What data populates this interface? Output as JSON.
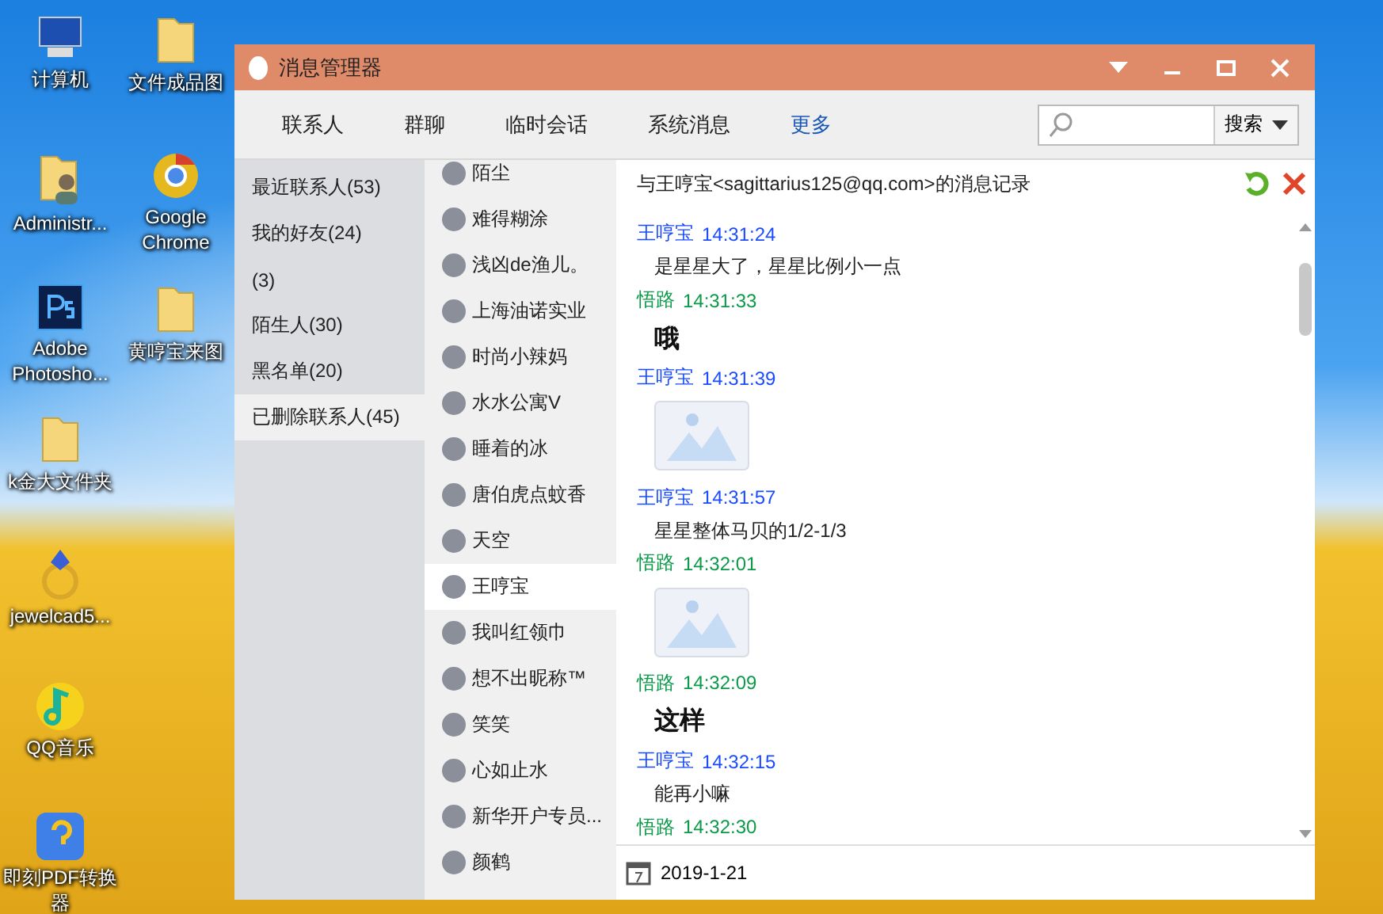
{
  "desktop_columns": [
    {
      "icons": [
        {
          "label": "计算机",
          "kind": "computer"
        },
        {
          "label": "Administr...",
          "kind": "user-folder"
        },
        {
          "label": "Adobe Photosho...",
          "kind": "ps"
        },
        {
          "label": "k金大文件夹",
          "kind": "folder"
        },
        {
          "label": "jewelcad5...",
          "kind": "ring"
        },
        {
          "label": "QQ音乐",
          "kind": "music"
        },
        {
          "label": "即刻PDF转换器",
          "kind": "pdf"
        }
      ]
    },
    {
      "icons": [
        {
          "label": "文件成品图",
          "kind": "folder"
        },
        {
          "label": "Google Chrome",
          "kind": "browser"
        },
        {
          "label": "黄哼宝来图",
          "kind": "folder"
        }
      ]
    }
  ],
  "window": {
    "title": "消息管理器"
  },
  "tabs": [
    {
      "label": "联系人",
      "kind": "tab"
    },
    {
      "label": "群聊",
      "kind": "tab"
    },
    {
      "label": "临时会话",
      "kind": "tab"
    },
    {
      "label": "系统消息",
      "kind": "tab"
    },
    {
      "label": "更多",
      "kind": "more"
    }
  ],
  "search": {
    "button": "搜索"
  },
  "categories": [
    {
      "label": "最近联系人(53)",
      "selected": false
    },
    {
      "label": "我的好友(24)",
      "selected": false
    },
    {
      "label": "(3)",
      "selected": false
    },
    {
      "label": "陌生人(30)",
      "selected": false
    },
    {
      "label": "黑名单(20)",
      "selected": false
    },
    {
      "label": "已删除联系人(45)",
      "selected": true
    }
  ],
  "contacts": [
    {
      "name": "陌尘",
      "selected": false
    },
    {
      "name": "难得糊涂",
      "selected": false
    },
    {
      "name": "浅凶de渔儿。",
      "selected": false
    },
    {
      "name": "上海油诺实业",
      "selected": false
    },
    {
      "name": "时尚小辣妈",
      "selected": false
    },
    {
      "name": "水水公寓V",
      "selected": false
    },
    {
      "name": "睡着的冰",
      "selected": false
    },
    {
      "name": "唐伯虎点蚊香",
      "selected": false
    },
    {
      "name": "天空",
      "selected": false
    },
    {
      "name": "王哼宝",
      "selected": true
    },
    {
      "name": "我叫红领巾",
      "selected": false
    },
    {
      "name": "想不出昵称™",
      "selected": false
    },
    {
      "name": "笑笑",
      "selected": false
    },
    {
      "name": "心如止水",
      "selected": false
    },
    {
      "name": "新华开户专员...",
      "selected": false
    },
    {
      "name": "颜鹤",
      "selected": false
    }
  ],
  "chat": {
    "title": "与王哼宝<sagittarius125@qq.com>的消息记录",
    "messages": [
      {
        "kind": "header",
        "sender": "王哼宝",
        "time": "14:31:24",
        "color": "#1a4cff"
      },
      {
        "kind": "text",
        "text": "是星星大了，星星比例小一点"
      },
      {
        "kind": "header",
        "sender": "悟路",
        "time": "14:31:33",
        "color": "#0a9a48"
      },
      {
        "kind": "big",
        "text": "哦"
      },
      {
        "kind": "header",
        "sender": "王哼宝",
        "time": "14:31:39",
        "color": "#1a4cff"
      },
      {
        "kind": "image"
      },
      {
        "kind": "header",
        "sender": "王哼宝",
        "time": "14:31:57",
        "color": "#1a4cff"
      },
      {
        "kind": "text",
        "text": "星星整体马贝的1/2-1/3"
      },
      {
        "kind": "header",
        "sender": "悟路",
        "time": "14:32:01",
        "color": "#0a9a48"
      },
      {
        "kind": "image"
      },
      {
        "kind": "header",
        "sender": "悟路",
        "time": "14:32:09",
        "color": "#0a9a48"
      },
      {
        "kind": "big",
        "text": "这样"
      },
      {
        "kind": "header",
        "sender": "王哼宝",
        "time": "14:32:15",
        "color": "#1a4cff"
      },
      {
        "kind": "text",
        "text": "能再小嘛"
      },
      {
        "kind": "header",
        "sender": "悟路",
        "time": "14:32:30",
        "color": "#0a9a48"
      }
    ],
    "date": "2019-1-21"
  }
}
